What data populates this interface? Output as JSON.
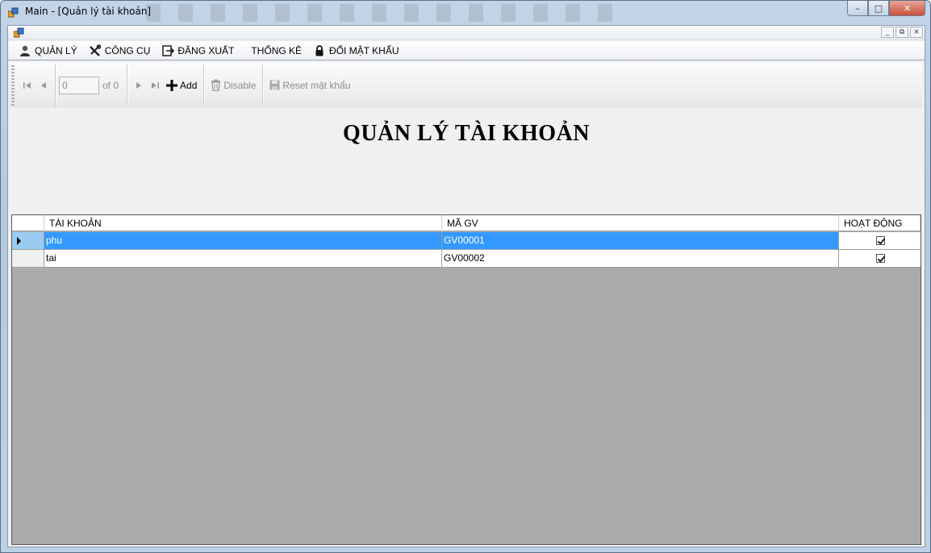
{
  "window": {
    "title": "Main - [Quản lý tài khoản]",
    "minimize_glyph": "–",
    "maximize_glyph": "□",
    "close_glyph": "✕"
  },
  "mdi": {
    "minimize_glyph": "_",
    "restore_glyph": "⧉",
    "close_glyph": "×"
  },
  "menu": [
    {
      "label": "QUẢN LÝ",
      "icon": "user-icon"
    },
    {
      "label": "CÔNG CỤ",
      "icon": "tools-icon"
    },
    {
      "label": "ĐĂNG XUẤT",
      "icon": "logout-icon"
    },
    {
      "label": "THỐNG KÊ",
      "icon": ""
    },
    {
      "label": "ĐỔI MẬT KHẨU",
      "icon": "lock-icon"
    }
  ],
  "toolbar": {
    "position_value": "0",
    "of_label": "of 0",
    "add_label": "Add",
    "disable_label": "Disable",
    "reset_label": "Reset mật khẩu"
  },
  "page": {
    "heading": "QUẢN LÝ TÀI KHOẢN"
  },
  "grid": {
    "columns": [
      "TÀI KHOẢN",
      "MÃ GV",
      "HOẠT ĐỘNG"
    ],
    "rows": [
      {
        "account": "phu",
        "code": "GV00001",
        "active": true,
        "selected": true
      },
      {
        "account": "tai",
        "code": "GV00002",
        "active": true,
        "selected": false
      }
    ]
  },
  "colors": {
    "selection": "#3399ff",
    "grid_background": "#ababab",
    "client_background": "#f0f0f0"
  }
}
